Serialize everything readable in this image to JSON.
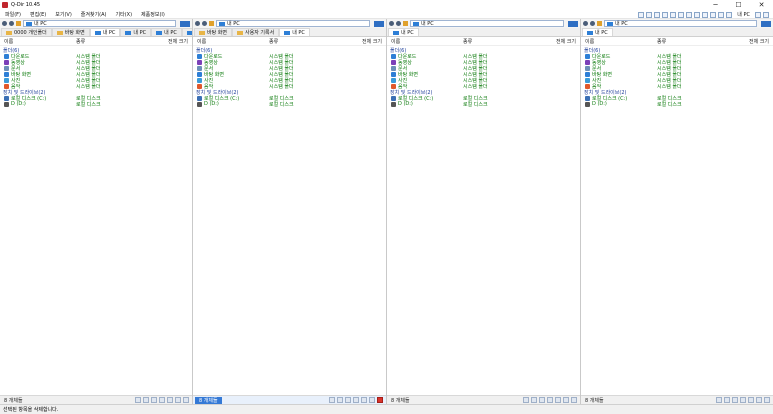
{
  "window": {
    "title": "Q-Dir 10.45",
    "min": "─",
    "max": "☐",
    "close": "✕"
  },
  "menu": [
    "파일(F)",
    "편집(E)",
    "보기(V)",
    "즐겨찾기(A)",
    "기타(X)",
    "제품정보(I)"
  ],
  "topright": {
    "label": "내 PC"
  },
  "columns": {
    "name": "이름",
    "type": "종류",
    "size": "전체 크기"
  },
  "panes": [
    {
      "address": "내 PC",
      "tabs": [
        {
          "label": "0000 개인폴더",
          "kind": "folder"
        },
        {
          "label": "바탕 화면",
          "kind": "folder"
        },
        {
          "label": "내 PC",
          "kind": "pc"
        },
        {
          "label": "내 PC",
          "kind": "pc"
        },
        {
          "label": "내 PC",
          "kind": "pc"
        },
        {
          "label": "내",
          "kind": "pc"
        }
      ],
      "status": "8 개체들"
    },
    {
      "address": "내 PC",
      "tabs": [
        {
          "label": "바탕 화면",
          "kind": "folder"
        },
        {
          "label": "사용자 기록서",
          "kind": "folder"
        },
        {
          "label": "내 PC",
          "kind": "pc"
        }
      ],
      "status": "8 개체들"
    },
    {
      "address": "내 PC",
      "tabs": [
        {
          "label": "내 PC",
          "kind": "pc"
        }
      ],
      "status": "8 개체들"
    },
    {
      "address": "내 PC",
      "tabs": [
        {
          "label": "내 PC",
          "kind": "pc"
        }
      ],
      "status": "8 개체들"
    }
  ],
  "groups": {
    "folders": "폴더(6)",
    "drives": "장치 및 드라이브(2)"
  },
  "folders": [
    {
      "name": "다운로드",
      "type": "시스템 폴더",
      "color": "#2e7fd6"
    },
    {
      "name": "동영상",
      "type": "시스템 폴더",
      "color": "#7b3fb8"
    },
    {
      "name": "문서",
      "type": "시스템 폴더",
      "color": "#6c8fb8"
    },
    {
      "name": "바탕 화면",
      "type": "시스템 폴더",
      "color": "#2e7fd6"
    },
    {
      "name": "사진",
      "type": "시스템 폴더",
      "color": "#3a9bd9"
    },
    {
      "name": "음악",
      "type": "시스템 폴더",
      "color": "#e0582b"
    }
  ],
  "drives": [
    {
      "name": "로컬 디스크 (C:)",
      "type": "로컬 디스크",
      "color": "#3b6fb5"
    },
    {
      "name": "D (D:)",
      "type": "로컬 디스크",
      "color": "#555555"
    }
  ],
  "bottom_status": "선택된 항목을 삭제합니다."
}
